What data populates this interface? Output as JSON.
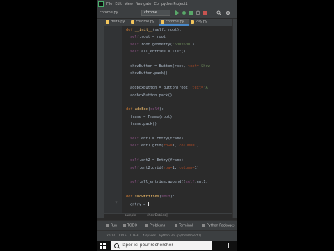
{
  "menu": {
    "items": [
      "File",
      "Edit",
      "View",
      "Navigate",
      "Co"
    ],
    "project_crumb": "pythonProject1"
  },
  "toolbar": {
    "crumb": "chrome.py",
    "run_config": "chrome"
  },
  "tabs": [
    "delta.py",
    "chrome.py",
    "chrome.py",
    "Play.py"
  ],
  "side_labels": {
    "left": [
      "Project",
      "Structure",
      "Favorites"
    ],
    "right": [
      "SciView",
      "Database"
    ]
  },
  "code_lines": [
    {
      "n": "",
      "tokens": [
        [
          "kw",
          "def "
        ],
        [
          "fn",
          "__init__"
        ],
        [
          "",
          "(self, root):"
        ]
      ]
    },
    {
      "n": "",
      "tokens": [
        [
          "sf",
          "self"
        ],
        [
          "",
          ".root = root"
        ]
      ]
    },
    {
      "n": "",
      "tokens": [
        [
          "sf",
          "self"
        ],
        [
          "",
          ".root.geometry("
        ],
        [
          "st",
          "'600x600'"
        ],
        [
          "",
          ")"
        ]
      ]
    },
    {
      "n": "",
      "tokens": [
        [
          "sf",
          "self"
        ],
        [
          "",
          ".all_entries = list()"
        ]
      ]
    },
    {
      "n": "",
      "tokens": [
        [
          "",
          ""
        ]
      ]
    },
    {
      "n": "",
      "tokens": [
        [
          "",
          "showButton = Button(root, "
        ],
        [
          "pr",
          "text="
        ],
        [
          "st",
          "'Show"
        ]
      ]
    },
    {
      "n": "",
      "tokens": [
        [
          "",
          "showButton.pack()"
        ]
      ]
    },
    {
      "n": "",
      "tokens": [
        [
          "",
          ""
        ]
      ]
    },
    {
      "n": "",
      "tokens": [
        [
          "",
          "addboxButton = Button(root, "
        ],
        [
          "pr",
          "text="
        ],
        [
          "st",
          "'A"
        ]
      ]
    },
    {
      "n": "",
      "tokens": [
        [
          "",
          "addboxButton.pack()"
        ]
      ]
    },
    {
      "n": "",
      "tokens": [
        [
          "",
          ""
        ]
      ]
    },
    {
      "n": "",
      "tokens": [
        [
          "kw",
          "def "
        ],
        [
          "fn",
          "addBox"
        ],
        [
          "",
          "("
        ],
        [
          "sf",
          "self"
        ],
        [
          "",
          "):"
        ]
      ]
    },
    {
      "n": "",
      "tokens": [
        [
          "",
          "frame = Frame(root)"
        ]
      ]
    },
    {
      "n": "",
      "tokens": [
        [
          "",
          "frame.pack()"
        ]
      ]
    },
    {
      "n": "",
      "tokens": [
        [
          "",
          ""
        ]
      ]
    },
    {
      "n": "",
      "tokens": [
        [
          "sf",
          "self"
        ],
        [
          "",
          ".ent1 = Entry(frame)"
        ]
      ]
    },
    {
      "n": "",
      "tokens": [
        [
          "sf",
          "self"
        ],
        [
          "",
          ".ent1.grid("
        ],
        [
          "pr",
          "row="
        ],
        [
          "",
          "1, "
        ],
        [
          "pr",
          "column="
        ],
        [
          "",
          "1)"
        ]
      ]
    },
    {
      "n": "",
      "tokens": [
        [
          "",
          ""
        ]
      ]
    },
    {
      "n": "",
      "tokens": [
        [
          "sf",
          "self"
        ],
        [
          "",
          ".ent2 = Entry(frame)"
        ]
      ]
    },
    {
      "n": "",
      "tokens": [
        [
          "sf",
          "self"
        ],
        [
          "",
          ".ent2.grid("
        ],
        [
          "pr",
          "row="
        ],
        [
          "",
          "1, "
        ],
        [
          "pr",
          "column="
        ],
        [
          "",
          "1)"
        ]
      ]
    },
    {
      "n": "",
      "tokens": [
        [
          "",
          ""
        ]
      ]
    },
    {
      "n": "",
      "tokens": [
        [
          "sf",
          "self"
        ],
        [
          "",
          ".all_entries.append(("
        ],
        [
          "sf",
          "self"
        ],
        [
          "",
          ".ent1,"
        ]
      ]
    },
    {
      "n": "",
      "tokens": [
        [
          "",
          ""
        ]
      ]
    },
    {
      "n": "",
      "tokens": [
        [
          "kw",
          "def "
        ],
        [
          "fn",
          "showEntries"
        ],
        [
          "",
          "("
        ],
        [
          "sf",
          "self"
        ],
        [
          "",
          "):"
        ]
      ]
    },
    {
      "n": "21",
      "tokens": [
        [
          "",
          "entry = "
        ]
      ]
    }
  ],
  "line_numbers": [
    "",
    "",
    "",
    "",
    "",
    "",
    "",
    "",
    "",
    "",
    "",
    "",
    "",
    "",
    "",
    "",
    "",
    "",
    "",
    "",
    "",
    "",
    "",
    "",
    "21"
  ],
  "breadcrumb": [
    "sample",
    "showEntries()"
  ],
  "bottom_tabs": [
    "Run",
    "TODO",
    "Problems",
    "Terminal",
    "Python Packages"
  ],
  "status": {
    "pos": "20:12",
    "eol": "CRLF",
    "enc": "UTF-8",
    "indent": "4 spaces",
    "interp": "Python 3.9 (pythonProject1)"
  },
  "taskbar": {
    "search_placeholder": "Taper ici pour rechercher"
  },
  "colors": {
    "editor_bg": "#2b2b2b",
    "keyword": "#cc7832",
    "self": "#94558d",
    "function": "#ffc66d",
    "string": "#6a8759",
    "param": "#aa4926"
  }
}
